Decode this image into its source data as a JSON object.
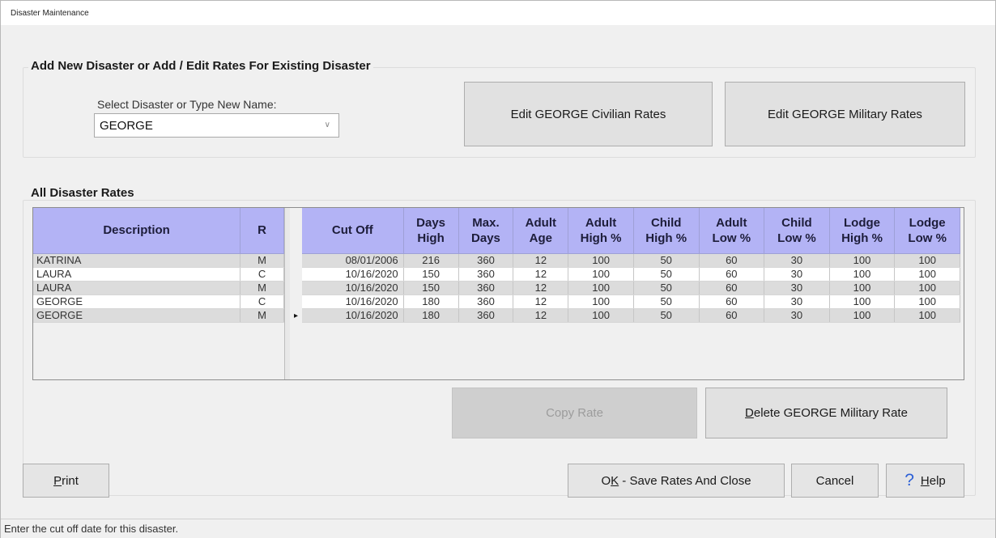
{
  "window": {
    "title": "Disaster Maintenance"
  },
  "add_group": {
    "title": "Add New Disaster or Add / Edit Rates For Existing Disaster",
    "select_label": "Select Disaster or Type New Name:",
    "select_value": "GEORGE",
    "civilian_button": "Edit GEORGE Civilian Rates",
    "military_button": "Edit GEORGE Military Rates"
  },
  "rates_group": {
    "title": "All Disaster Rates",
    "left_columns": [
      "Description",
      "R"
    ],
    "right_columns": [
      [
        "Cut Off"
      ],
      [
        "Days",
        "High"
      ],
      [
        "Max.",
        "Days"
      ],
      [
        "Adult",
        "Age"
      ],
      [
        "Adult",
        "High %"
      ],
      [
        "Child",
        "High %"
      ],
      [
        "Adult",
        "Low %"
      ],
      [
        "Child",
        "Low %"
      ],
      [
        "Lodge",
        "High %"
      ],
      [
        "Lodge",
        "Low %"
      ]
    ],
    "rows": [
      [
        "KATRINA",
        "M",
        "08/01/2006",
        "216",
        "360",
        "12",
        "100",
        "50",
        "60",
        "30",
        "100",
        "100"
      ],
      [
        "LAURA",
        "C",
        "10/16/2020",
        "150",
        "360",
        "12",
        "100",
        "50",
        "60",
        "30",
        "100",
        "100"
      ],
      [
        "LAURA",
        "M",
        "10/16/2020",
        "150",
        "360",
        "12",
        "100",
        "50",
        "60",
        "30",
        "100",
        "100"
      ],
      [
        "GEORGE",
        "C",
        "10/16/2020",
        "180",
        "360",
        "12",
        "100",
        "50",
        "60",
        "30",
        "100",
        "100"
      ],
      [
        "GEORGE",
        "M",
        "10/16/2020",
        "180",
        "360",
        "12",
        "100",
        "50",
        "60",
        "30",
        "100",
        "100"
      ]
    ],
    "current_row_marker": "▸"
  },
  "buttons": {
    "copy_rate": "Copy Rate",
    "delete_rate_accel": "D",
    "delete_rate_rest": "elete GEORGE Military Rate",
    "print_accel": "P",
    "print_rest": "rint",
    "ok_prefix": "O",
    "ok_accel": "K",
    "ok_rest": " - Save Rates And Close",
    "cancel": "Cancel",
    "help_icon": "?",
    "help_accel": "H",
    "help_rest": "elp"
  },
  "status": {
    "text": "Enter the cut off date for this disaster."
  },
  "colors": {
    "header_bg": "#b3b3f5",
    "row_alt": "#dcdcdc",
    "help_icon": "#2b5fd6"
  }
}
